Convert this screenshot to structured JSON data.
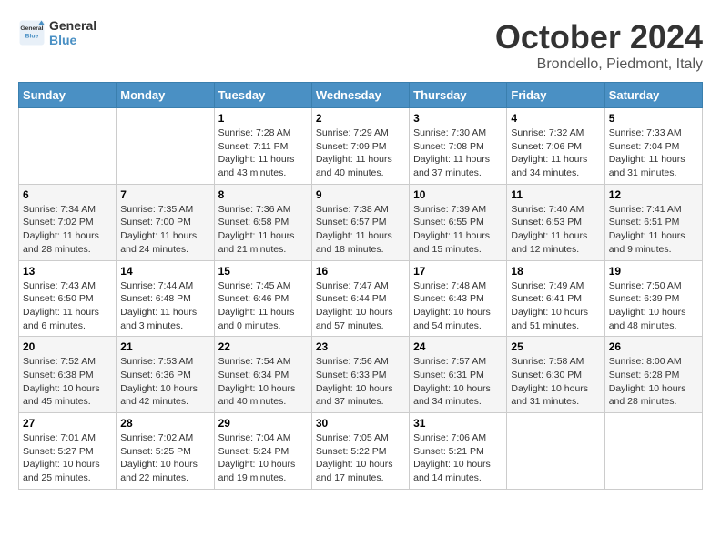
{
  "logo": {
    "line1": "General",
    "line2": "Blue"
  },
  "title": "October 2024",
  "subtitle": "Brondello, Piedmont, Italy",
  "headers": [
    "Sunday",
    "Monday",
    "Tuesday",
    "Wednesday",
    "Thursday",
    "Friday",
    "Saturday"
  ],
  "weeks": [
    [
      {
        "day": "",
        "info": ""
      },
      {
        "day": "",
        "info": ""
      },
      {
        "day": "1",
        "info": "Sunrise: 7:28 AM\nSunset: 7:11 PM\nDaylight: 11 hours and 43 minutes."
      },
      {
        "day": "2",
        "info": "Sunrise: 7:29 AM\nSunset: 7:09 PM\nDaylight: 11 hours and 40 minutes."
      },
      {
        "day": "3",
        "info": "Sunrise: 7:30 AM\nSunset: 7:08 PM\nDaylight: 11 hours and 37 minutes."
      },
      {
        "day": "4",
        "info": "Sunrise: 7:32 AM\nSunset: 7:06 PM\nDaylight: 11 hours and 34 minutes."
      },
      {
        "day": "5",
        "info": "Sunrise: 7:33 AM\nSunset: 7:04 PM\nDaylight: 11 hours and 31 minutes."
      }
    ],
    [
      {
        "day": "6",
        "info": "Sunrise: 7:34 AM\nSunset: 7:02 PM\nDaylight: 11 hours and 28 minutes."
      },
      {
        "day": "7",
        "info": "Sunrise: 7:35 AM\nSunset: 7:00 PM\nDaylight: 11 hours and 24 minutes."
      },
      {
        "day": "8",
        "info": "Sunrise: 7:36 AM\nSunset: 6:58 PM\nDaylight: 11 hours and 21 minutes."
      },
      {
        "day": "9",
        "info": "Sunrise: 7:38 AM\nSunset: 6:57 PM\nDaylight: 11 hours and 18 minutes."
      },
      {
        "day": "10",
        "info": "Sunrise: 7:39 AM\nSunset: 6:55 PM\nDaylight: 11 hours and 15 minutes."
      },
      {
        "day": "11",
        "info": "Sunrise: 7:40 AM\nSunset: 6:53 PM\nDaylight: 11 hours and 12 minutes."
      },
      {
        "day": "12",
        "info": "Sunrise: 7:41 AM\nSunset: 6:51 PM\nDaylight: 11 hours and 9 minutes."
      }
    ],
    [
      {
        "day": "13",
        "info": "Sunrise: 7:43 AM\nSunset: 6:50 PM\nDaylight: 11 hours and 6 minutes."
      },
      {
        "day": "14",
        "info": "Sunrise: 7:44 AM\nSunset: 6:48 PM\nDaylight: 11 hours and 3 minutes."
      },
      {
        "day": "15",
        "info": "Sunrise: 7:45 AM\nSunset: 6:46 PM\nDaylight: 11 hours and 0 minutes."
      },
      {
        "day": "16",
        "info": "Sunrise: 7:47 AM\nSunset: 6:44 PM\nDaylight: 10 hours and 57 minutes."
      },
      {
        "day": "17",
        "info": "Sunrise: 7:48 AM\nSunset: 6:43 PM\nDaylight: 10 hours and 54 minutes."
      },
      {
        "day": "18",
        "info": "Sunrise: 7:49 AM\nSunset: 6:41 PM\nDaylight: 10 hours and 51 minutes."
      },
      {
        "day": "19",
        "info": "Sunrise: 7:50 AM\nSunset: 6:39 PM\nDaylight: 10 hours and 48 minutes."
      }
    ],
    [
      {
        "day": "20",
        "info": "Sunrise: 7:52 AM\nSunset: 6:38 PM\nDaylight: 10 hours and 45 minutes."
      },
      {
        "day": "21",
        "info": "Sunrise: 7:53 AM\nSunset: 6:36 PM\nDaylight: 10 hours and 42 minutes."
      },
      {
        "day": "22",
        "info": "Sunrise: 7:54 AM\nSunset: 6:34 PM\nDaylight: 10 hours and 40 minutes."
      },
      {
        "day": "23",
        "info": "Sunrise: 7:56 AM\nSunset: 6:33 PM\nDaylight: 10 hours and 37 minutes."
      },
      {
        "day": "24",
        "info": "Sunrise: 7:57 AM\nSunset: 6:31 PM\nDaylight: 10 hours and 34 minutes."
      },
      {
        "day": "25",
        "info": "Sunrise: 7:58 AM\nSunset: 6:30 PM\nDaylight: 10 hours and 31 minutes."
      },
      {
        "day": "26",
        "info": "Sunrise: 8:00 AM\nSunset: 6:28 PM\nDaylight: 10 hours and 28 minutes."
      }
    ],
    [
      {
        "day": "27",
        "info": "Sunrise: 7:01 AM\nSunset: 5:27 PM\nDaylight: 10 hours and 25 minutes."
      },
      {
        "day": "28",
        "info": "Sunrise: 7:02 AM\nSunset: 5:25 PM\nDaylight: 10 hours and 22 minutes."
      },
      {
        "day": "29",
        "info": "Sunrise: 7:04 AM\nSunset: 5:24 PM\nDaylight: 10 hours and 19 minutes."
      },
      {
        "day": "30",
        "info": "Sunrise: 7:05 AM\nSunset: 5:22 PM\nDaylight: 10 hours and 17 minutes."
      },
      {
        "day": "31",
        "info": "Sunrise: 7:06 AM\nSunset: 5:21 PM\nDaylight: 10 hours and 14 minutes."
      },
      {
        "day": "",
        "info": ""
      },
      {
        "day": "",
        "info": ""
      }
    ]
  ]
}
